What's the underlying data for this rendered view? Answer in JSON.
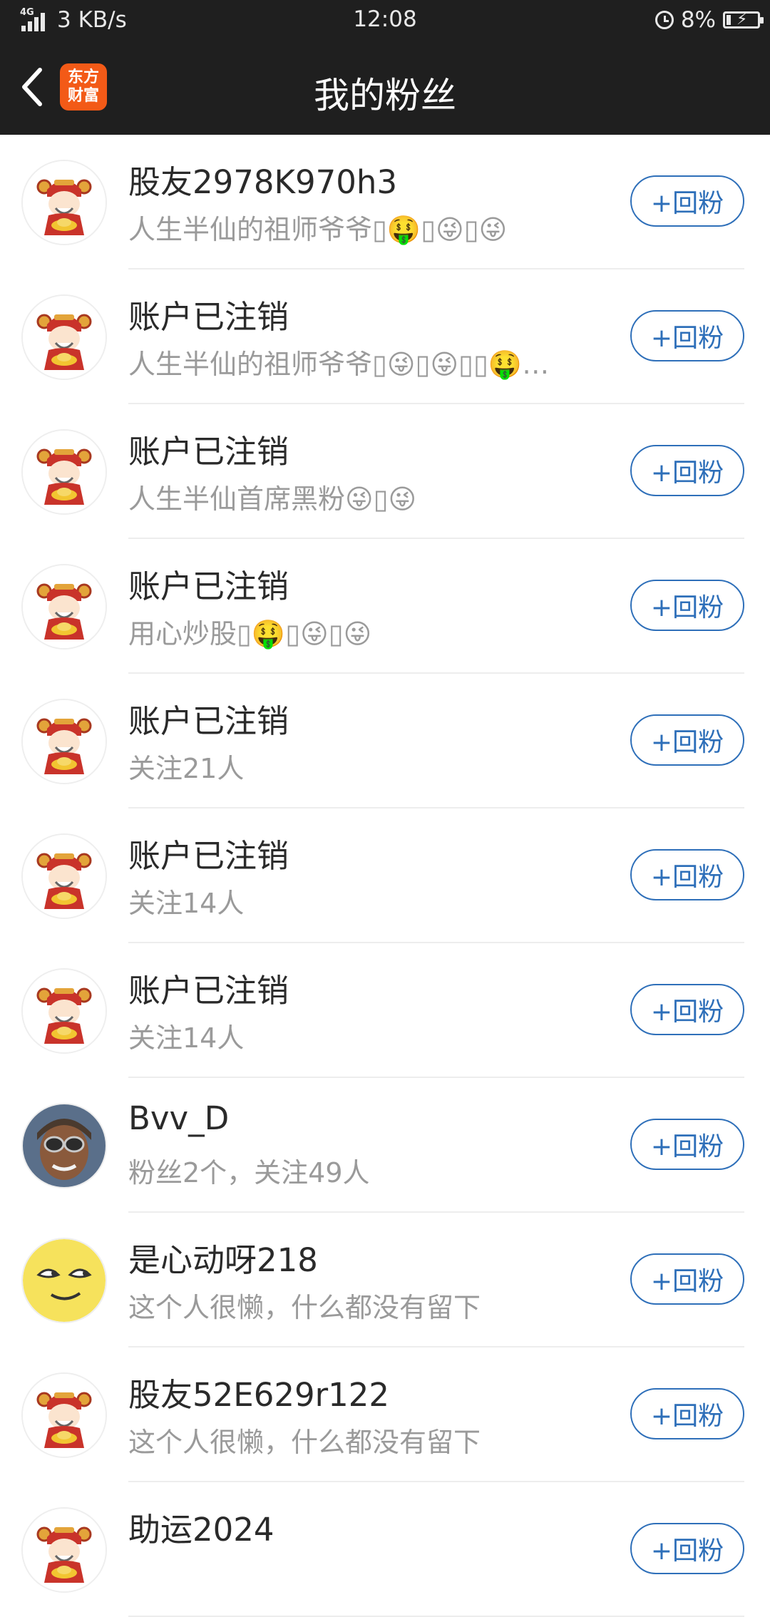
{
  "status_bar": {
    "network": "4G",
    "speed": "3 KB/s",
    "time": "12:08",
    "battery": "8%"
  },
  "header": {
    "logo_text": "东方\n财富",
    "title": "我的粉丝"
  },
  "follow_button_label": "+回粉",
  "fans": [
    {
      "name": "股友2978K970h3",
      "desc": "人生半仙的祖师爷爷▯🤑▯😜▯😜",
      "avatar": "fortune-god-avatar"
    },
    {
      "name": "账户已注销",
      "desc": "人生半仙的祖师爷爷▯😜▯😜▯▯🤑…",
      "avatar": "fortune-god-avatar"
    },
    {
      "name": "账户已注销",
      "desc": "人生半仙首席黑粉😜▯😜",
      "avatar": "fortune-god-avatar"
    },
    {
      "name": "账户已注销",
      "desc": "用心炒股▯🤑▯😜▯😜",
      "avatar": "fortune-god-avatar"
    },
    {
      "name": "账户已注销",
      "desc": "关注21人",
      "avatar": "fortune-god-avatar"
    },
    {
      "name": "账户已注销",
      "desc": "关注14人",
      "avatar": "fortune-god-avatar"
    },
    {
      "name": "账户已注销",
      "desc": "关注14人",
      "avatar": "fortune-god-avatar"
    },
    {
      "name": "Bvv_D",
      "desc": "粉丝2个，关注49人",
      "avatar": "pilot-photo-avatar"
    },
    {
      "name": "是心动呀218",
      "desc": "这个人很懒，什么都没有留下",
      "avatar": "smug-emoji-avatar"
    },
    {
      "name": "股友52E629r122",
      "desc": "这个人很懒，什么都没有留下",
      "avatar": "fortune-god-avatar"
    },
    {
      "name": "助运2024",
      "desc": "",
      "avatar": "fortune-god-avatar"
    }
  ],
  "colors": {
    "header_bg": "#1f1f1f",
    "brand_orange": "#f35a17",
    "button_blue": "#2e6fb9"
  }
}
